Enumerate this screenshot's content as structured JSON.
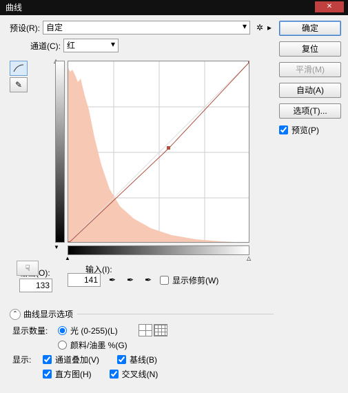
{
  "title": "曲线",
  "preset": {
    "label": "预设(R):",
    "value": "自定"
  },
  "channel": {
    "label": "通道(C):",
    "value": "红"
  },
  "output": {
    "label": "输出(O):",
    "value": "133"
  },
  "input": {
    "label": "输入(I):",
    "value": "141"
  },
  "showClipping": {
    "label": "显示修剪(W)",
    "checked": false
  },
  "displayOptions": {
    "title": "曲线显示选项",
    "amountLabel": "显示数量:",
    "light": "光 (0-255)(L)",
    "pigment": "颜料/油墨 %(G)",
    "showLabel": "显示:",
    "channelOverlay": "通道叠加(V)",
    "baseline": "基线(B)",
    "histogram": "直方图(H)",
    "intersection": "交叉线(N)"
  },
  "buttons": {
    "ok": "确定",
    "reset": "复位",
    "smooth": "平滑(M)",
    "auto": "自动(A)",
    "options": "选项(T)...",
    "preview": "预览(P)"
  },
  "chart_data": {
    "type": "line",
    "title": "",
    "xlabel": "输入",
    "ylabel": "输出",
    "xlim": [
      0,
      255
    ],
    "ylim": [
      0,
      255
    ],
    "curve_points": [
      [
        0,
        0
      ],
      [
        141,
        133
      ],
      [
        255,
        255
      ]
    ],
    "histogram_channel": "红"
  }
}
